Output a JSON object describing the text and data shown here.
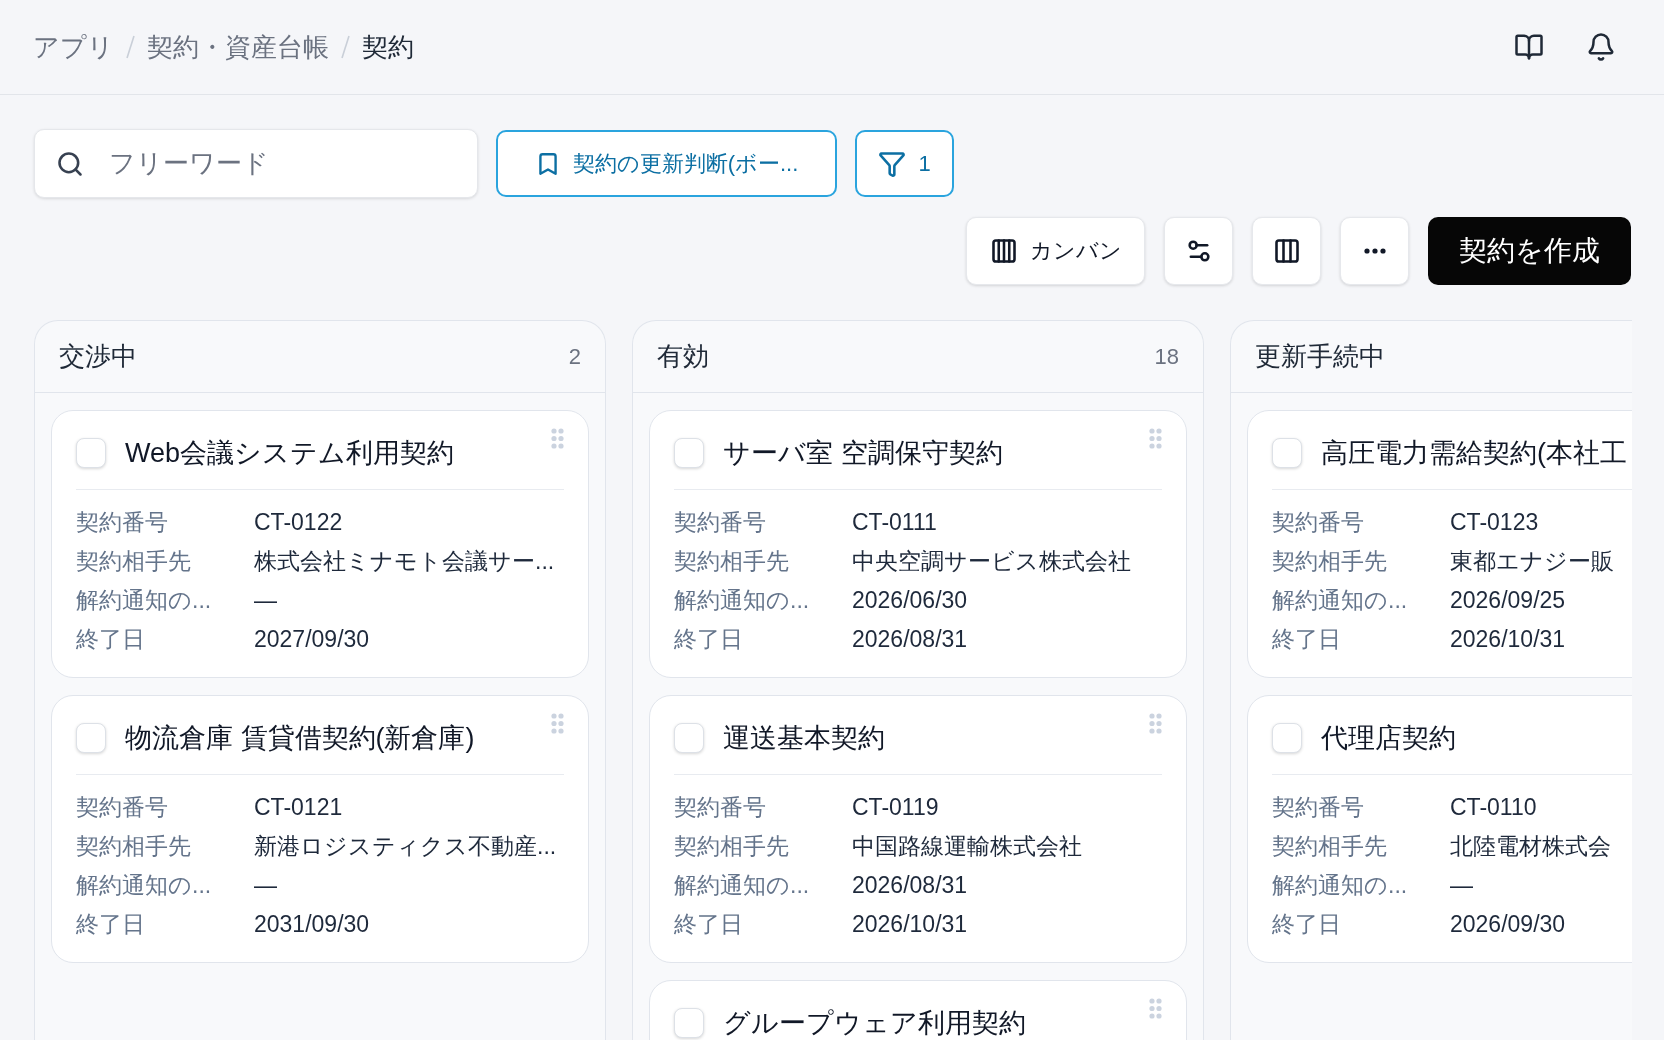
{
  "breadcrumb": [
    {
      "label": "アプリ",
      "current": false
    },
    {
      "label": "契約・資産台帳",
      "current": false
    },
    {
      "label": "契約",
      "current": true
    }
  ],
  "search": {
    "placeholder": "フリーワード"
  },
  "saved_view": {
    "label": "契約の更新判断(ボー..."
  },
  "filter": {
    "count": "1"
  },
  "view_switch": {
    "label": "カンバン"
  },
  "create_button": {
    "label": "契約を作成"
  },
  "columns": [
    {
      "title": "交渉中",
      "count": "2",
      "cards": [
        {
          "title": "Web会議システム利用契約",
          "checked": false,
          "fields": [
            {
              "label": "契約番号",
              "value": "CT-0122"
            },
            {
              "label": "契約相手先",
              "value": "株式会社ミナモト会議サー..."
            },
            {
              "label": "解約通知の...",
              "value": "—"
            },
            {
              "label": "終了日",
              "value": "2027/09/30"
            }
          ]
        },
        {
          "title": "物流倉庫 賃貸借契約(新倉庫)",
          "checked": false,
          "fields": [
            {
              "label": "契約番号",
              "value": "CT-0121"
            },
            {
              "label": "契約相手先",
              "value": "新港ロジスティクス不動産..."
            },
            {
              "label": "解約通知の...",
              "value": "—"
            },
            {
              "label": "終了日",
              "value": "2031/09/30"
            }
          ]
        }
      ]
    },
    {
      "title": "有効",
      "count": "18",
      "cards": [
        {
          "title": "サーバ室 空調保守契約",
          "checked": false,
          "fields": [
            {
              "label": "契約番号",
              "value": "CT-0111"
            },
            {
              "label": "契約相手先",
              "value": "中央空調サービス株式会社"
            },
            {
              "label": "解約通知の...",
              "value": "2026/06/30"
            },
            {
              "label": "終了日",
              "value": "2026/08/31"
            }
          ]
        },
        {
          "title": "運送基本契約",
          "checked": false,
          "fields": [
            {
              "label": "契約番号",
              "value": "CT-0119"
            },
            {
              "label": "契約相手先",
              "value": "中国路線運輸株式会社"
            },
            {
              "label": "解約通知の...",
              "value": "2026/08/31"
            },
            {
              "label": "終了日",
              "value": "2026/10/31"
            }
          ]
        },
        {
          "title": "グループウェア利用契約",
          "checked": false
        }
      ]
    },
    {
      "title": "更新手続中",
      "cards": [
        {
          "title": "高圧電力需給契約(本社工",
          "checked": false,
          "fields": [
            {
              "label": "契約番号",
              "value": "CT-0123"
            },
            {
              "label": "契約相手先",
              "value": "東都エナジー販"
            },
            {
              "label": "解約通知の...",
              "value": "2026/09/25"
            },
            {
              "label": "終了日",
              "value": "2026/10/31"
            }
          ]
        },
        {
          "title": "代理店契約",
          "checked": false,
          "fields": [
            {
              "label": "契約番号",
              "value": "CT-0110"
            },
            {
              "label": "契約相手先",
              "value": "北陸電材株式会"
            },
            {
              "label": "解約通知の...",
              "value": "—"
            },
            {
              "label": "終了日",
              "value": "2026/09/30"
            }
          ]
        }
      ]
    }
  ]
}
